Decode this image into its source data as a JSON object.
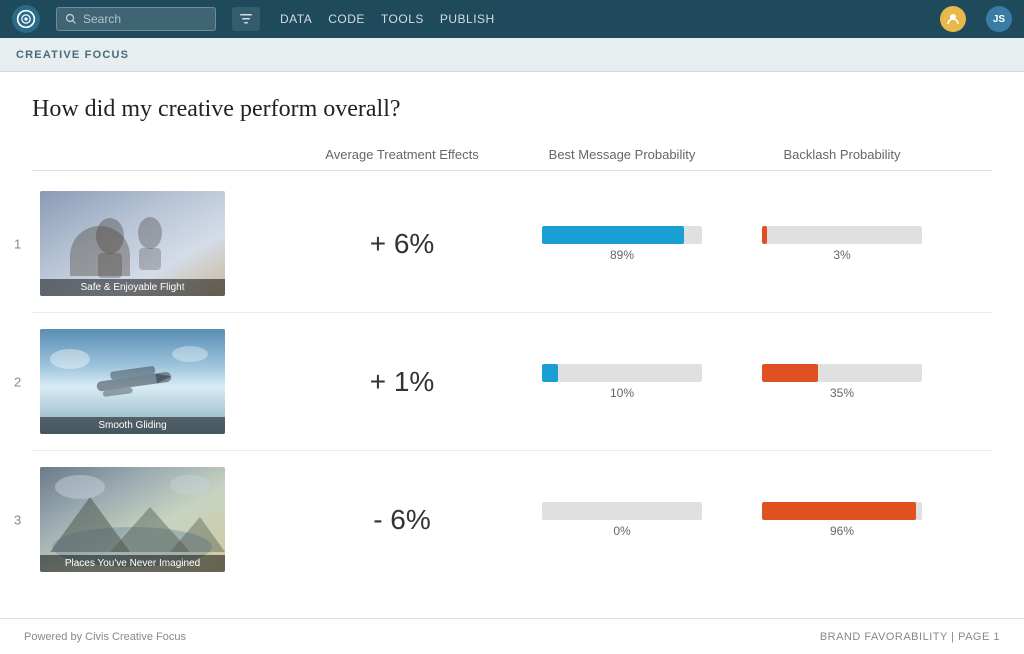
{
  "nav": {
    "search_placeholder": "Search",
    "links": [
      "DATA",
      "CODE",
      "TOOLS",
      "PUBLISH"
    ],
    "avatar1_initials": "",
    "avatar2_initials": "JS"
  },
  "breadcrumb": "CREATIVE FOCUS",
  "main": {
    "page_title": "How did my creative perform overall?",
    "col_headers": [
      "",
      "Average Treatment Effects",
      "Best Message Probability",
      "Backlash Probability"
    ],
    "rows": [
      {
        "number": "1",
        "label": "Safe & Enjoyable Flight",
        "ate": "+ 6%",
        "best_pct": 89,
        "best_label": "89%",
        "backlash_pct": 3,
        "backlash_label": "3%"
      },
      {
        "number": "2",
        "label": "Smooth Gliding",
        "ate": "+ 1%",
        "best_pct": 10,
        "best_label": "10%",
        "backlash_pct": 35,
        "backlash_label": "35%"
      },
      {
        "number": "3",
        "label": "Places You've Never Imagined",
        "ate": "- 6%",
        "best_pct": 0,
        "best_label": "0%",
        "backlash_pct": 96,
        "backlash_label": "96%"
      }
    ]
  },
  "footer": {
    "left": "Powered by Civis Creative Focus",
    "right": "BRAND FAVORABILITY | PAGE 1"
  }
}
